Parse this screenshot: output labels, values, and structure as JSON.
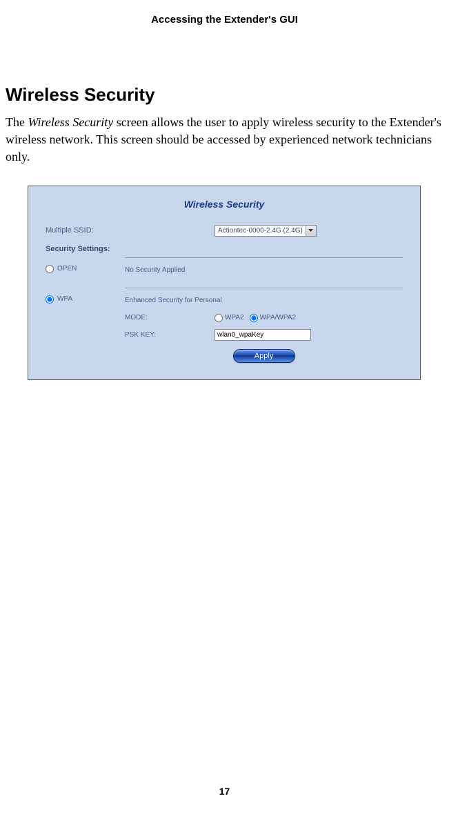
{
  "header": {
    "breadcrumb": "Accessing the Extender's GUI"
  },
  "section": {
    "heading": "Wireless Security",
    "para_pre": "The ",
    "para_em": "Wireless Security",
    "para_post": " screen allows the user to apply wireless security to the Extender's wireless network. This screen should be accessed by experienced network technicians only."
  },
  "panel": {
    "title": "Wireless Security",
    "ssid_label": "Multiple SSID:",
    "ssid_selected": "Actiontec-0000-2.4G (2.4G)",
    "security_settings_label": "Security Settings:",
    "open": {
      "label": "OPEN",
      "desc": "No Security Applied",
      "checked": false
    },
    "wpa": {
      "label": "WPA",
      "desc": "Enhanced Security for Personal",
      "checked": true,
      "mode_label": "MODE:",
      "mode_wpa2": "WPA2",
      "mode_wpawpa2": "WPA/WPA2",
      "mode_selected": "WPA/WPA2",
      "psk_label": "PSK KEY:",
      "psk_value": "wlan0_wpaKey"
    },
    "apply_label": "Apply"
  },
  "page_number": "17"
}
